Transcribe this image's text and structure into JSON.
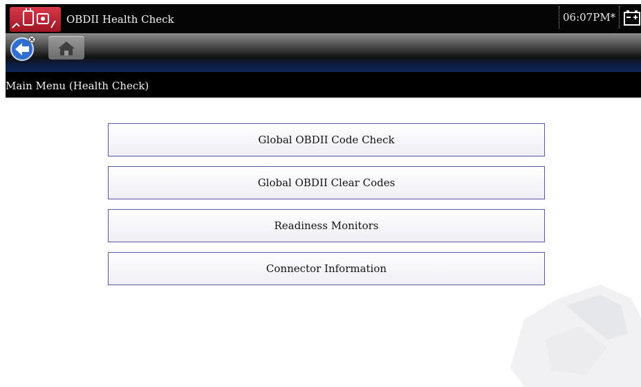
{
  "titlebar": {
    "title": "OBDII Health Check",
    "time": "06:07PM*",
    "logo_icon": "scan-tool-logo-icon",
    "status_icon": "battery-icon"
  },
  "toolbar": {
    "back_icon": "back-arrow-icon",
    "home_icon": "home-icon"
  },
  "breadcrumb": "Main Menu (Health Check)",
  "menu": [
    {
      "label": "Global OBDII Code Check"
    },
    {
      "label": "Global OBDII Clear Codes"
    },
    {
      "label": "Readiness Monitors"
    },
    {
      "label": "Connector Information"
    }
  ],
  "colors": {
    "accent_red": "#c8283a",
    "button_border": "#5a56a6",
    "toolbar_blue": "#10265a"
  }
}
